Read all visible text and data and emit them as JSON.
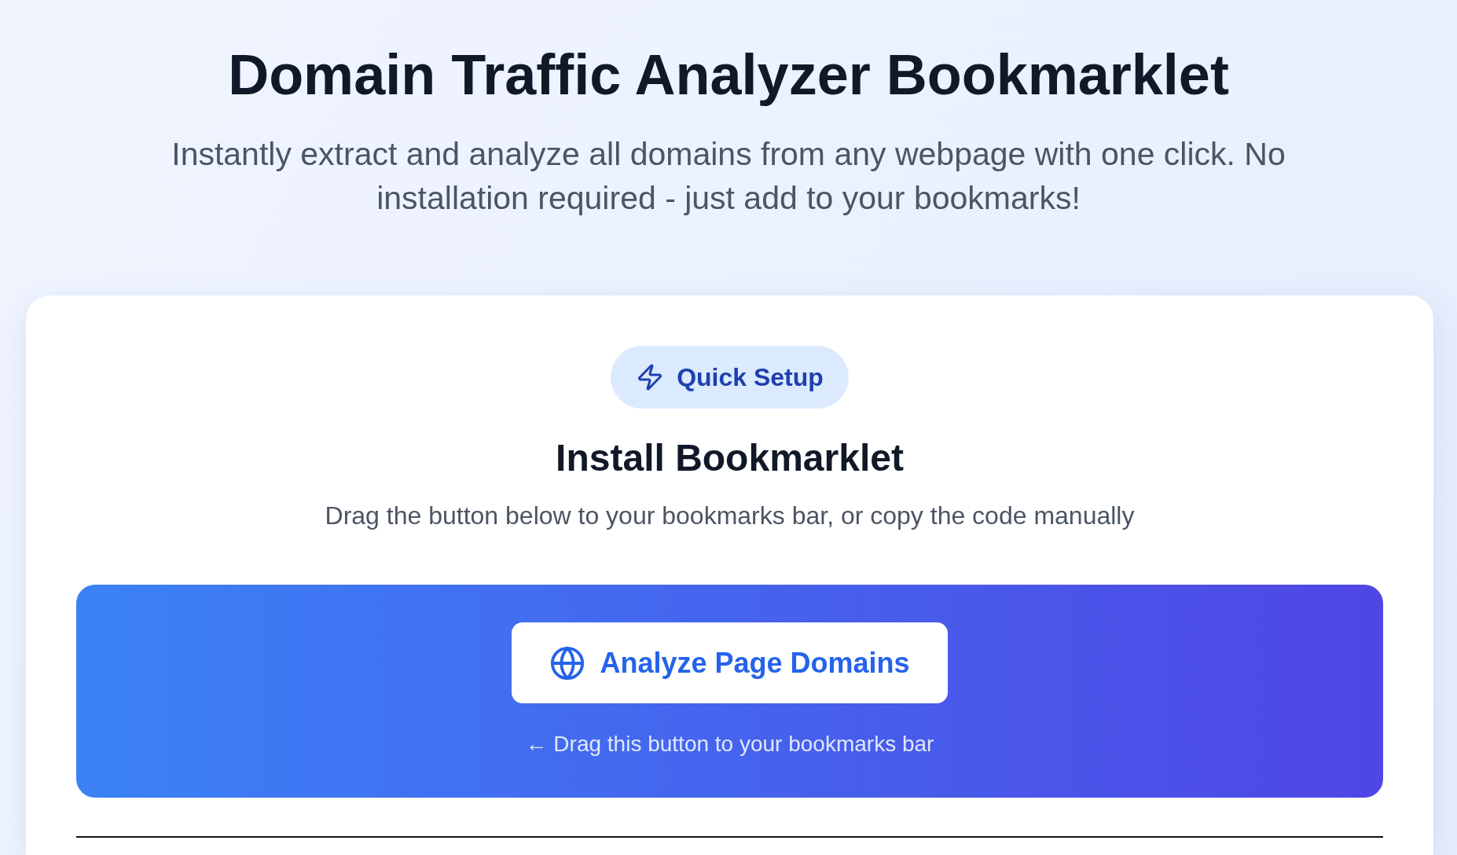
{
  "header": {
    "title": "Domain Traffic Analyzer Bookmarklet",
    "subtitle": "Instantly extract and analyze all domains from any webpage with one click. No installation required - just add to your bookmarks!"
  },
  "install_card": {
    "badge": {
      "label": "Quick Setup"
    },
    "title": "Install Bookmarklet",
    "description": "Drag the button below to your bookmarks bar, or copy the code manually",
    "bookmarklet": {
      "button": "Analyze Page Domains",
      "hint": "← Drag this button to your bookmarks bar"
    }
  }
}
